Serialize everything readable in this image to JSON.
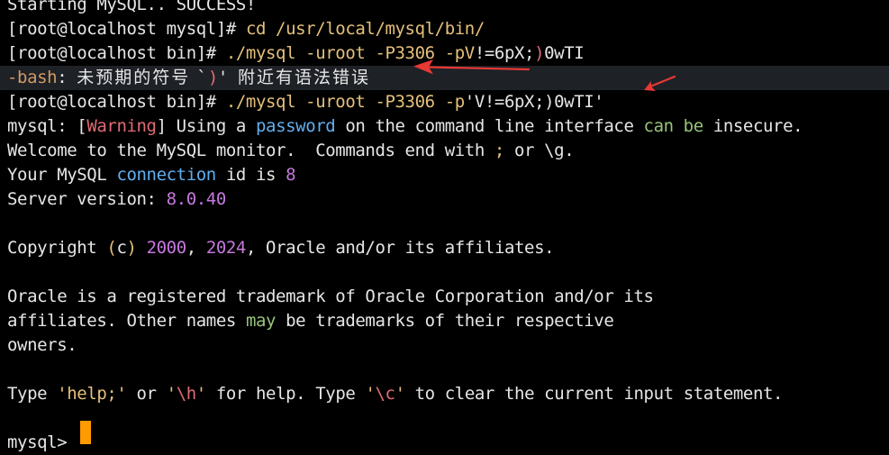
{
  "terminal": {
    "lines": [
      {
        "segments": [
          {
            "text": "Starting MySQL.. SUCCESS!",
            "color": "white"
          }
        ]
      },
      {
        "segments": [
          {
            "text": "[root@localhost mysql]# ",
            "color": "white"
          },
          {
            "text": "cd /usr/local/mysql/bin/",
            "color": "yellow"
          }
        ]
      },
      {
        "segments": [
          {
            "text": "[root@localhost bin]# ",
            "color": "white"
          },
          {
            "text": "./mysql -uroot -P3306 -pV",
            "color": "yellow"
          },
          {
            "text": "!=6pX;",
            "color": "white"
          },
          {
            "text": ")",
            "color": "red"
          },
          {
            "text": "0wTI",
            "color": "white"
          }
        ]
      },
      {
        "highlight": true,
        "segments": [
          {
            "text": "-bash",
            "color": "orange"
          },
          {
            "text": ": ",
            "color": "white"
          },
          {
            "text": "未预期的符号 `",
            "color": "cjk"
          },
          {
            "text": ")",
            "color": "red"
          },
          {
            "text": "' ",
            "color": "white"
          },
          {
            "text": "附近有语法错误",
            "color": "cjk"
          }
        ]
      },
      {
        "segments": [
          {
            "text": "[root@localhost bin]# ",
            "color": "white"
          },
          {
            "text": "./mysql -uroot -P3306 -p",
            "color": "yellow"
          },
          {
            "text": "'V!=6pX;)0wTI'",
            "color": "white"
          }
        ]
      },
      {
        "segments": [
          {
            "text": "mysql: ",
            "color": "white"
          },
          {
            "text": "[",
            "color": "white"
          },
          {
            "text": "Warning",
            "color": "red"
          },
          {
            "text": "] Using a ",
            "color": "white"
          },
          {
            "text": "password",
            "color": "blue"
          },
          {
            "text": " on the command line interface ",
            "color": "white"
          },
          {
            "text": "can be",
            "color": "green"
          },
          {
            "text": " insecure.",
            "color": "white"
          }
        ]
      },
      {
        "segments": [
          {
            "text": "Welcome to the MySQL monitor.  Commands end with ",
            "color": "white"
          },
          {
            "text": ";",
            "color": "yellow"
          },
          {
            "text": " or \\g.",
            "color": "white"
          }
        ]
      },
      {
        "segments": [
          {
            "text": "Your MySQL ",
            "color": "white"
          },
          {
            "text": "connection",
            "color": "blue"
          },
          {
            "text": " id is ",
            "color": "white"
          },
          {
            "text": "8",
            "color": "purple"
          }
        ]
      },
      {
        "segments": [
          {
            "text": "Server version: ",
            "color": "white"
          },
          {
            "text": "8.0.40",
            "color": "purple"
          }
        ]
      },
      {
        "segments": []
      },
      {
        "segments": [
          {
            "text": "Copyright ",
            "color": "white"
          },
          {
            "text": "(",
            "color": "yellow"
          },
          {
            "text": "c",
            "color": "white"
          },
          {
            "text": ")",
            "color": "yellow"
          },
          {
            "text": " ",
            "color": "white"
          },
          {
            "text": "2000",
            "color": "purple"
          },
          {
            "text": ", ",
            "color": "white"
          },
          {
            "text": "2024",
            "color": "purple"
          },
          {
            "text": ", Oracle and/or its affiliates.",
            "color": "white"
          }
        ]
      },
      {
        "segments": []
      },
      {
        "segments": [
          {
            "text": "Oracle is a registered trademark of Oracle Corporation and/or its",
            "color": "white"
          }
        ]
      },
      {
        "segments": [
          {
            "text": "affiliates. Other names ",
            "color": "white"
          },
          {
            "text": "may",
            "color": "green"
          },
          {
            "text": " be trademarks of their respective",
            "color": "white"
          }
        ]
      },
      {
        "segments": [
          {
            "text": "owners.",
            "color": "white"
          }
        ]
      },
      {
        "segments": []
      },
      {
        "segments": [
          {
            "text": "Type ",
            "color": "white"
          },
          {
            "text": "'help;'",
            "color": "yellow"
          },
          {
            "text": " or ",
            "color": "white"
          },
          {
            "text": "'",
            "color": "yellow"
          },
          {
            "text": "\\h",
            "color": "red"
          },
          {
            "text": "'",
            "color": "yellow"
          },
          {
            "text": " for help. Type ",
            "color": "white"
          },
          {
            "text": "'",
            "color": "yellow"
          },
          {
            "text": "\\c",
            "color": "red"
          },
          {
            "text": "'",
            "color": "yellow"
          },
          {
            "text": " to clear the current input statement.",
            "color": "white"
          }
        ]
      },
      {
        "segments": []
      },
      {
        "segments": [
          {
            "text": "mysql> ",
            "color": "white"
          }
        ]
      }
    ],
    "colors": {
      "background": "#000000",
      "highlight_row": "#1e2126",
      "white": "#e6e6e6",
      "yellow": "#e5c07b",
      "orange": "#d19a66",
      "red": "#e06c75",
      "blue": "#61afef",
      "green": "#98c379",
      "purple": "#c678dd",
      "cursor": "#ff9a00",
      "annotation_arrow": "#e53935"
    },
    "cursor_icon": "block-cursor-icon",
    "annotations": [
      "red-arrow-icon",
      "red-arrow-icon"
    ]
  }
}
